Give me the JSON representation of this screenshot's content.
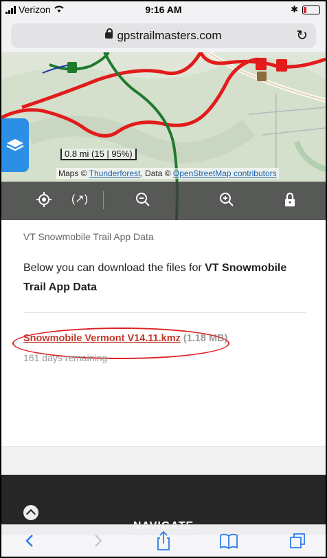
{
  "status": {
    "carrier": "Verizon",
    "time": "9:16 AM"
  },
  "url": {
    "host": "gpstrailmasters.com"
  },
  "map": {
    "scale": "0.8 mi (15 | 95%)",
    "attribution": {
      "prefix": "Maps © ",
      "thunderforest": "Thunderforest",
      "middle": ", Data © ",
      "osm": "OpenStreetMap contributors"
    }
  },
  "page": {
    "breadcrumb": "VT Snowmobile Trail App Data",
    "description_prefix": "Below you can download the files for ",
    "description_bold": "VT Snowmobile Trail App Data",
    "file": {
      "name": "Snowmobile Vermont V14.11.kmz",
      "size": " (1.18 MB)",
      "remaining": "161 days remaining"
    }
  },
  "footer": {
    "navigate": "NAVIGATE"
  },
  "colors": {
    "link": "#c0392b",
    "accent": "#2b7de9",
    "trail_red": "#e21b1b",
    "trail_green": "#1f7a2d"
  }
}
